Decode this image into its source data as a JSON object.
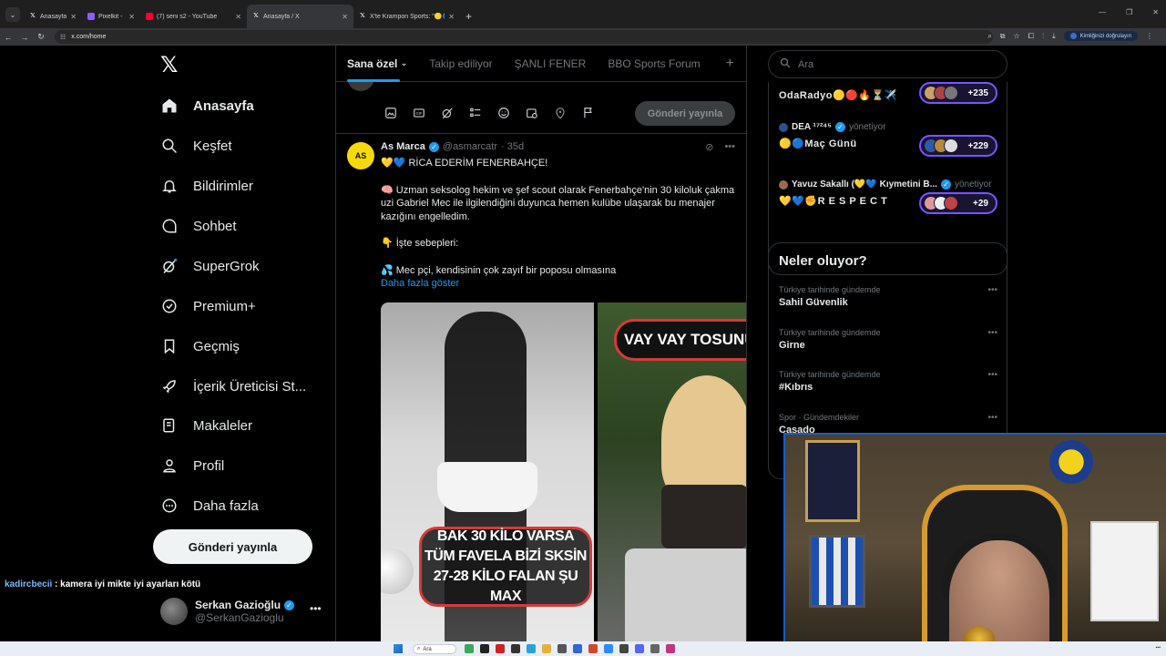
{
  "browser": {
    "tabs": [
      {
        "title": "Anasayfa",
        "favicon": "x-icon",
        "color": "#ffffff"
      },
      {
        "title": "Pixelkit -",
        "favicon": "pixelkit-icon",
        "color": "#8e5bff"
      },
      {
        "title": "(7) seni s2 - YouTube",
        "favicon": "youtube-icon",
        "color": "#ff0033"
      },
      {
        "title": "Anasayfa / X",
        "favicon": "x-icon",
        "color": "#ffffff",
        "active": true
      },
      {
        "title": "X'te Krampon Sports: \"🟡🔵 A",
        "favicon": "x-icon",
        "color": "#ffffff"
      }
    ],
    "url": "x.com/home",
    "identity_chip": "Kimliğinizi doğrulayın"
  },
  "nav": {
    "items": [
      {
        "label": "Anasayfa",
        "icon": "home-icon",
        "active": true
      },
      {
        "label": "Keşfet",
        "icon": "search-icon"
      },
      {
        "label": "Bildirimler",
        "icon": "bell-icon"
      },
      {
        "label": "Sohbet",
        "icon": "chat-icon"
      },
      {
        "label": "SuperGrok",
        "icon": "grok-icon"
      },
      {
        "label": "Premium+",
        "icon": "verified-icon"
      },
      {
        "label": "Geçmiş",
        "icon": "bookmark-icon"
      },
      {
        "label": "İçerik Üreticisi St...",
        "icon": "rocket-icon"
      },
      {
        "label": "Makaleler",
        "icon": "article-icon"
      },
      {
        "label": "Profil",
        "icon": "person-icon"
      },
      {
        "label": "Daha fazla",
        "icon": "more-circle-icon"
      }
    ],
    "post_button": "Gönderi yayınla"
  },
  "chat_overlay": {
    "user": "kadircbecii",
    "message": ": kamera iyi mikte iyi ayarları kötü"
  },
  "account": {
    "name": "Serkan Gazioğlu",
    "handle": "@SerkanGazioglu"
  },
  "feed": {
    "tabs": [
      "Sana özel",
      "Takip ediliyor",
      "ŞANLI FENER",
      "BBO Sports Forum"
    ],
    "active_tab": "Sana özel",
    "compose_post": "Gönderi yayınla"
  },
  "tweet": {
    "avatar_text": "AS",
    "name": "As Marca",
    "handle": "@asmarcatr",
    "time": "· 35d",
    "lines": [
      "💛💙 RİCA EDERİM FENERBAHÇE!",
      "🧠 Uzman seksolog hekim ve şef scout olarak Fenerbahçe'nin 30 kiloluk çakma uzi Gabriel Mec ile ilgilendiğini duyunca hemen kulübe ulaşarak bu menajer kazığını engelledim.",
      "👇 İşte sebepleri:",
      "💦 Mec pçi, kendisinin çok zayıf bir poposu olmasına"
    ],
    "show_more": "Daha fazla göster",
    "media_caption_1": [
      "BAK 30 KİLO VARSA",
      "TÜM FAVELA BİZİ SKSİN",
      "27-28 KİLO FALAN ŞU MAX"
    ],
    "media_caption_2": "VAY VAY TOSUNUM"
  },
  "search": {
    "placeholder": "Ara"
  },
  "spaces": [
    {
      "host": "",
      "role": "",
      "title": "OdaRadyo🟡🔴🔥⏳✈️",
      "count": "+235"
    },
    {
      "host": "DEA ¹⁷²⁴⁵",
      "role": "yönetiyor",
      "title": "🟡🔵Maç Günü",
      "count": "+229"
    },
    {
      "host": "Yavuz Sakallı (💛💙 Kıymetini B...",
      "role": "yönetiyor",
      "title": "💛💙✊R E S P E C T",
      "count": "+29"
    }
  ],
  "trends": {
    "heading": "Neler oluyor?",
    "items": [
      {
        "context": "Türkiye tarihinde gündemde",
        "name": "Sahil Güvenlik"
      },
      {
        "context": "Türkiye tarihinde gündemde",
        "name": "Girne"
      },
      {
        "context": "Türkiye tarihinde gündemde",
        "name": "#Kıbrıs"
      },
      {
        "context": "Spor · Gündemdekiler",
        "name": "Casado"
      }
    ]
  },
  "taskbar": {
    "search": "Ara"
  }
}
